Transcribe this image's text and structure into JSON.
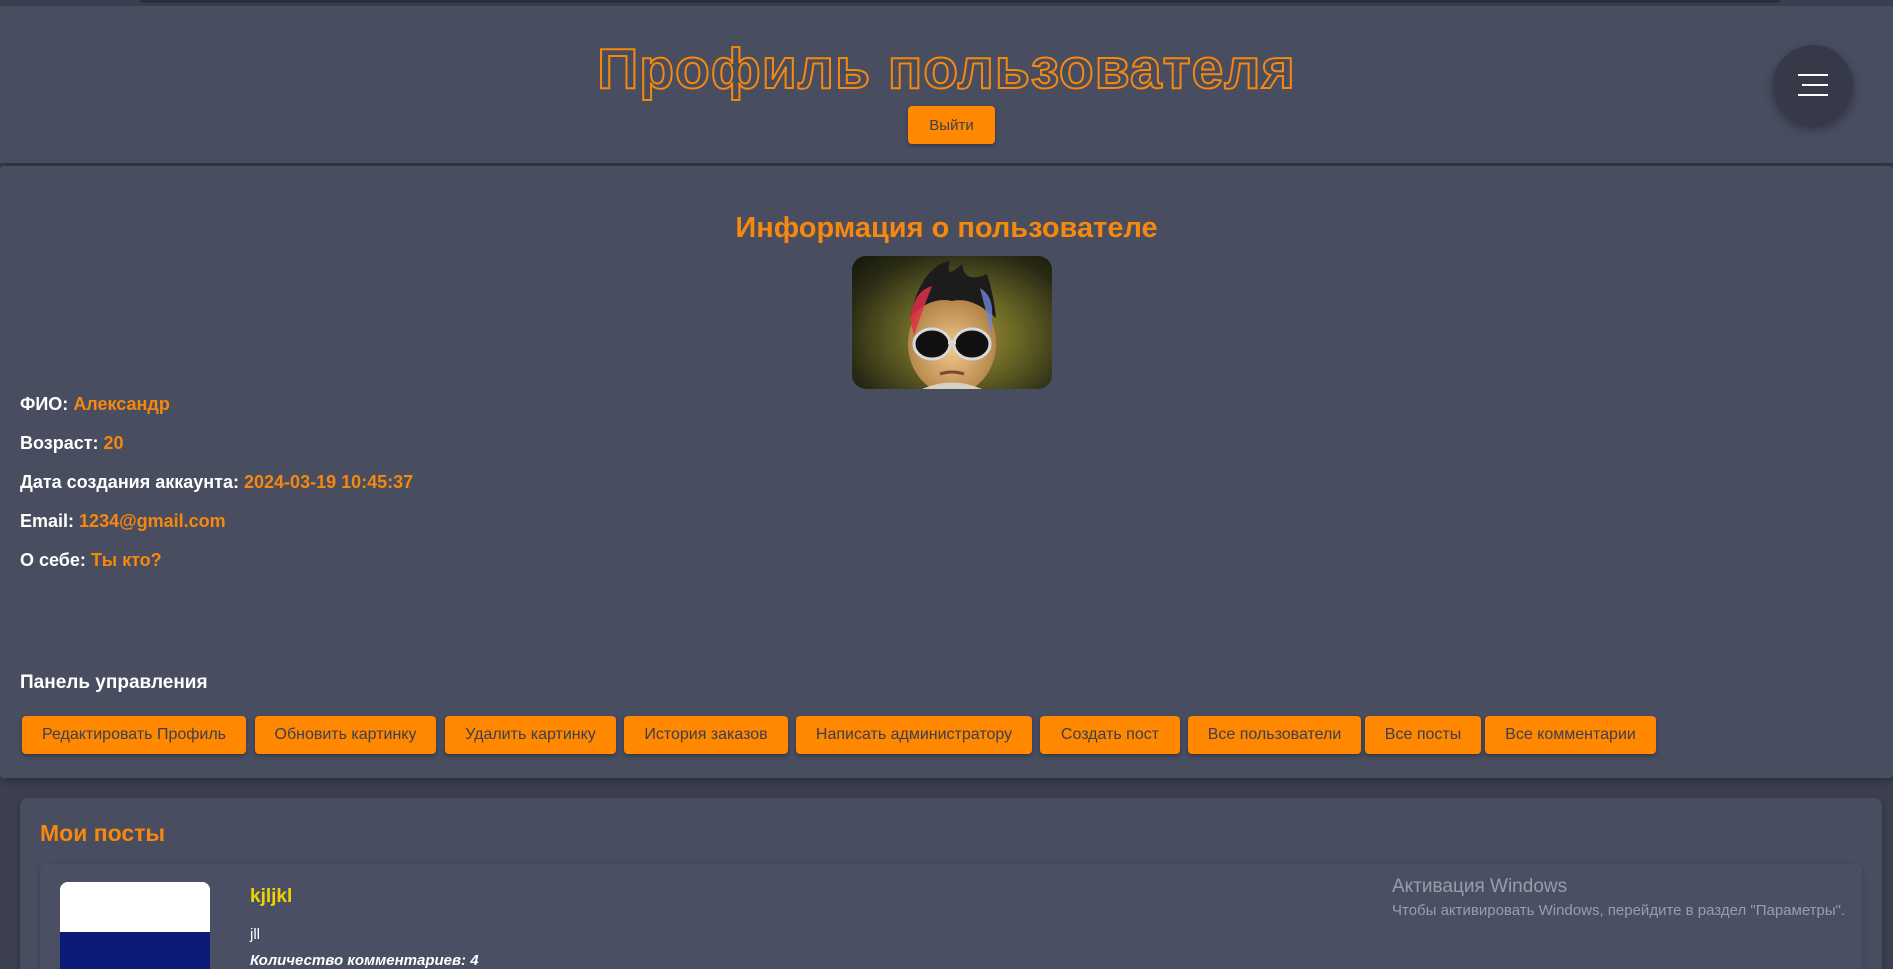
{
  "header": {
    "title": "Профиль пользователя",
    "logout_label": "Выйти",
    "menu_icon": "hamburger-icon"
  },
  "info": {
    "title": "Информация о пользователе",
    "avatar": "avatar-photo",
    "fields": [
      {
        "label": "ФИО:",
        "value": "Александр"
      },
      {
        "label": "Возраст:",
        "value": "20"
      },
      {
        "label": "Дата создания аккаунта:",
        "value": "2024-03-19 10:45:37"
      },
      {
        "label": "Email:",
        "value": "1234@gmail.com"
      },
      {
        "label": "О себе:",
        "value": "Ты кто?"
      }
    ],
    "panel_title": "Панель управления",
    "actions": [
      "Редактировать Профиль",
      "Обновить картинку",
      "Удалить картинку",
      "История заказов",
      "Написать администратору",
      "Создать пост",
      "Все пользователи",
      "Все посты",
      "Все комментарии"
    ]
  },
  "posts": {
    "title": "Мои посты",
    "items": [
      {
        "title": "kjljkl",
        "body": "jll",
        "comments": "Количество комментариев: 4"
      }
    ]
  },
  "system": {
    "activation_title": "Активация Windows",
    "activation_text": "Чтобы активировать Windows, перейдите в раздел \"Параметры\"."
  },
  "colors": {
    "background": "#3b3f4f",
    "card": "#484d60",
    "accent": "#ff8800",
    "post_title": "#f2d200"
  }
}
